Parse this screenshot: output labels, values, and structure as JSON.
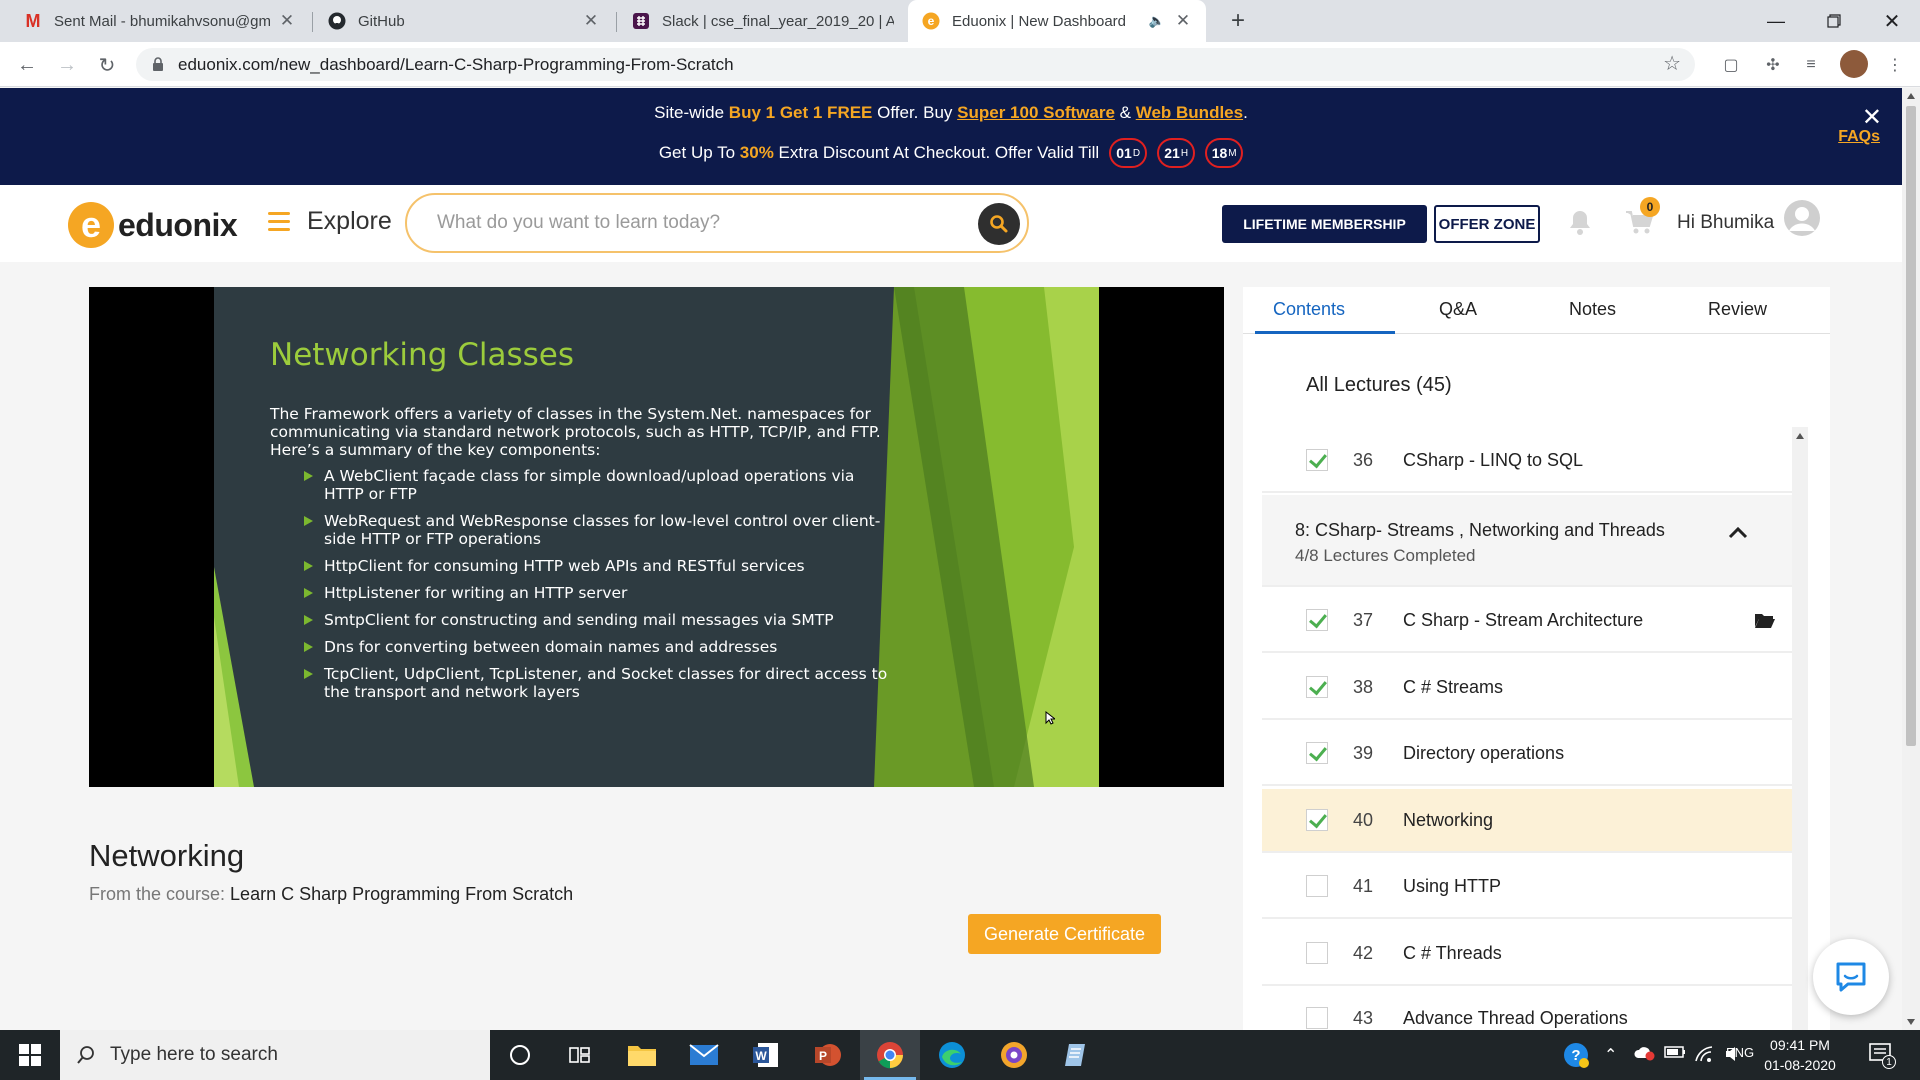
{
  "browser": {
    "tabs": [
      {
        "label": "Sent Mail - bhumikahvsonu@gm",
        "icon": "gmail-icon"
      },
      {
        "label": "GitHub",
        "icon": "github-icon"
      },
      {
        "label": "Slack | cse_final_year_2019_20 | A",
        "icon": "slack-icon"
      },
      {
        "label": "Eduonix | New Dashboard",
        "icon": "eduonix-icon",
        "active": true
      }
    ],
    "url": "eduonix.com/new_dashboard/Learn-C-Sharp-Programming-From-Scratch"
  },
  "promo": {
    "l1_a": "Site-wide ",
    "l1_b": "Buy 1 Get 1 FREE",
    "l1_c": " Offer. Buy ",
    "l1_d": "Super 100 Software",
    "l1_e": " & ",
    "l1_f": "Web Bundles",
    "l1_g": ".",
    "l2_a": "Get Up To ",
    "l2_b": "30%",
    "l2_c": " Extra Discount At Checkout. Offer Valid Till",
    "days": "01",
    "days_unit": "D",
    "hours": "21",
    "hours_unit": "H",
    "minutes": "18",
    "minutes_unit": "M",
    "faqs": "FAQs"
  },
  "header": {
    "logo_letter": "e",
    "logo_word": "eduonix",
    "explore": "Explore",
    "search_placeholder": "What do you want to learn today?",
    "lifetime": "LIFETIME MEMBERSHIP",
    "offer_zone": "OFFER ZONE",
    "cart_count": "0",
    "greeting": "Hi Bhumika"
  },
  "slide": {
    "title": "Networking Classes",
    "intro": "The Framework offers a variety of classes in the System.Net. namespaces for communicating via standard network protocols, such as HTTP, TCP/IP, and FTP. Here’s a summary of the key components:",
    "bullets": [
      "A WebClient façade class for simple download/upload operations via HTTP or FTP",
      "WebRequest and WebResponse classes for low-level control over client-side HTTP or FTP operations",
      "HttpClient for consuming HTTP web APIs and RESTful services",
      "HttpListener for writing an HTTP server",
      "SmtpClient for constructing and sending mail messages via SMTP",
      "Dns for converting between domain names and addresses",
      "TcpClient, UdpClient, TcpListener, and Socket classes for direct access to the transport and network layers"
    ]
  },
  "lecture": {
    "title": "Networking",
    "from_label": "From the course: ",
    "course_name": "Learn C Sharp Programming From Scratch",
    "certificate": "Generate Certificate"
  },
  "panel": {
    "tabs": [
      "Contents",
      "Q&A",
      "Notes",
      "Review"
    ],
    "all_lectures": "All Lectures (45)",
    "lectures": [
      {
        "num": "36",
        "title": "CSharp - LINQ to SQL",
        "checked": true
      },
      {
        "num": "37",
        "title": "C Sharp - Stream Architecture",
        "checked": true
      },
      {
        "num": "38",
        "title": "C # Streams",
        "checked": true
      },
      {
        "num": "39",
        "title": "Directory operations",
        "checked": true
      },
      {
        "num": "40",
        "title": "Networking",
        "checked": true
      },
      {
        "num": "41",
        "title": "Using HTTP",
        "checked": false
      },
      {
        "num": "42",
        "title": "C # Threads",
        "checked": false
      },
      {
        "num": "43",
        "title": "Advance Thread Operations",
        "checked": false
      }
    ],
    "section": {
      "title": "8: CSharp- Streams , Networking and Threads",
      "sub": "4/8 Lectures Completed"
    }
  },
  "taskbar": {
    "search_placeholder": "Type here to search",
    "lang": "ENG",
    "time": "09:41 PM",
    "date": "01-08-2020",
    "notif_count": "1"
  },
  "colors": {
    "brand_orange": "#f5a623",
    "navy": "#0d1a4a",
    "slide_green": "#9ccc3c",
    "current_row": "#fcf1d7"
  }
}
